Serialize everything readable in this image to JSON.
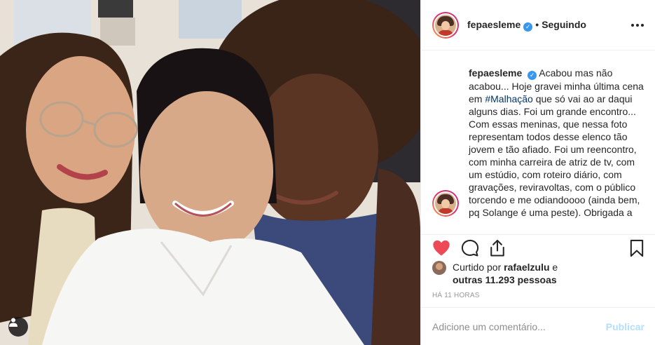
{
  "post": {
    "username": "fepaesleme",
    "verified_icon": "verified-badge-icon",
    "separator": "•",
    "follow_status": "Seguindo",
    "caption": {
      "username": "fepaesleme",
      "text_part1": "Acabou mas não acabou... Hoje gravei minha última cena em ",
      "hashtag": "#Malhação",
      "text_part2": " que só vai ao ar daqui alguns dias. Foi um grande encontro... Com essas meninas, que nessa foto representam todos desse elenco tão jovem e tão afiado. Foi um reencontro, com minha carreira de atriz de tv, com um estúdio, com roteiro diário, com gravações, reviravoltas, com o público torcendo e me odiandoooo (ainda bem, pq Solange é uma peste). Obrigada a"
    },
    "likes": {
      "prefix": "Curtido por",
      "liker": "rafaelzulu",
      "suffix": "e",
      "others": "outras 11.293 pessoas"
    },
    "timestamp": "HÁ 11 HORAS",
    "comment": {
      "placeholder": "Adicione um comentário...",
      "publish_label": "Publicar"
    },
    "colors": {
      "like_red": "#ed4956",
      "publish_disabled": "#b2dffc",
      "verified_blue": "#3897f0"
    }
  }
}
